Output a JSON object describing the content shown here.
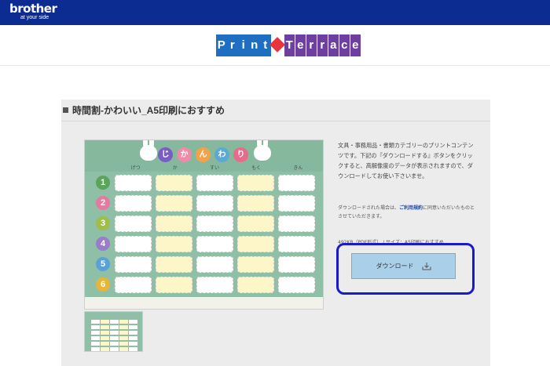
{
  "header": {
    "brand": "brother",
    "tagline": "at your side"
  },
  "site_logo": {
    "letters": [
      "P",
      "r",
      "i",
      "n",
      "t",
      "",
      "T",
      "e",
      "r",
      "r",
      "a",
      "c",
      "e"
    ],
    "colors": [
      "#1e6fc1",
      "#1e6fc1",
      "#1e6fc1",
      "#1e6fc1",
      "#1e6fc1",
      "#e8343c",
      "#6d3fa0",
      "#6d3fa0",
      "#6d3fa0",
      "#6d3fa0",
      "#6d3fa0",
      "#6d3fa0",
      "#6d3fa0"
    ]
  },
  "section": {
    "title": "時間割-かわいい_A5印刷におすすめ"
  },
  "preview": {
    "title_chars": [
      "じ",
      "か",
      "ん",
      "わ",
      "り"
    ],
    "title_colors": [
      "#7a5cc2",
      "#ef8aa8",
      "#f2a24a",
      "#5ca9d6",
      "#e86b8c"
    ],
    "days": [
      "げつ",
      "か",
      "すい",
      "もく",
      "きん"
    ],
    "periods": [
      "1",
      "2",
      "3",
      "4",
      "5",
      "6"
    ],
    "period_colors": [
      "#5aa55a",
      "#e57aa0",
      "#9ebd4a",
      "#9a7cc9",
      "#5aa2d6",
      "#e8b53a"
    ]
  },
  "description": {
    "text": "文具・事務用品・書類カテゴリーのプリントコンテンツです。下記の『ダウンロードする』ボタンをクリックすると、高解像度のデータが表示されますので、ダウンロードしてお使い下さいませ。",
    "note_before": "ダウンロードされた場合は、",
    "note_link": "ご利用規約",
    "note_after": "に同意いただいたものとさせていただきます。",
    "fileinfo": "492KB（PDF形式） / サイズ：A5印刷におすすめ"
  },
  "download": {
    "label": "ダウンロード",
    "icon": "download-icon"
  },
  "colors": {
    "header_bg": "#0d2c91",
    "button_bg": "#a9cfe9",
    "highlight": "#1a1ac8"
  }
}
